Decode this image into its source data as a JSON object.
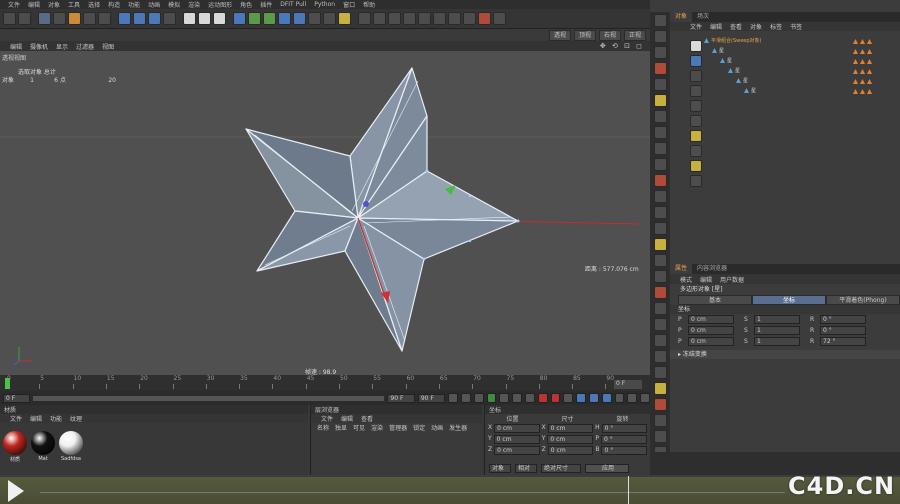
{
  "menu": [
    "文件",
    "编辑",
    "对象",
    "工具",
    "选择",
    "构造",
    "功能",
    "动画",
    "模拟",
    "渲染",
    "运动图形",
    "角色",
    "插件",
    "DFIT Pull",
    "Python",
    "窗口",
    "帮助"
  ],
  "viewport": {
    "view_buttons": [
      "透视",
      "顶视",
      "右视",
      "正视"
    ],
    "menu": [
      "编辑",
      "摄像机",
      "显示",
      "过滤器",
      "视图"
    ],
    "nav_icons": "✥ ⟲ ⊡ ◻",
    "title": "透视视图",
    "info_header": "选取对象 总计",
    "info_rows": [
      {
        "k": "对象",
        "a": "1",
        "b": "6"
      },
      {
        "k": "点",
        "a": "",
        "b": "20"
      }
    ],
    "distance": "距离 : 577.076 cm",
    "speed": "帧速 : 98.9"
  },
  "timeline": {
    "ticks": [
      "0",
      "5",
      "10",
      "15",
      "20",
      "25",
      "30",
      "35",
      "40",
      "45",
      "50",
      "55",
      "60",
      "65",
      "70",
      "75",
      "80",
      "85",
      "90"
    ],
    "frame": "0 F",
    "start": "0 F",
    "end": "90 F",
    "end2": "90 F"
  },
  "materials": {
    "title": "材质",
    "menu": [
      "文件",
      "编辑",
      "功能",
      "纹理"
    ],
    "items": [
      {
        "label": "材质",
        "color": "#c0281e"
      },
      {
        "label": "Mat",
        "color": "#111111"
      },
      {
        "label": "Sadfdsa",
        "color": "#f0f0f0"
      }
    ]
  },
  "layers": {
    "title": "层浏览器",
    "menu": [
      "文件",
      "编辑",
      "查看"
    ],
    "cols": [
      "名称",
      "独显",
      "可见",
      "渲染",
      "管理器",
      "锁定",
      "动画",
      "发生器"
    ]
  },
  "coords": {
    "title": "坐标",
    "cols": [
      "位置",
      "尺寸",
      "旋转"
    ],
    "rows": [
      {
        "a": "X",
        "pos": "0 cm",
        "b": "X",
        "size": "0 cm",
        "c": "H",
        "rot": "0 °"
      },
      {
        "a": "Y",
        "pos": "0 cm",
        "b": "Y",
        "size": "0 cm",
        "c": "P",
        "rot": "0 °"
      },
      {
        "a": "Z",
        "pos": "0 cm",
        "b": "Z",
        "size": "0 cm",
        "c": "B",
        "rot": "0 °"
      }
    ],
    "mode": "对象",
    "mode2": "相对",
    "mode3": "绝对尺寸",
    "apply": "应用"
  },
  "objects": {
    "tabs": [
      "对象",
      "场次"
    ],
    "menu": [
      "文件",
      "编辑",
      "查看",
      "对象",
      "标签",
      "书签"
    ],
    "rows": [
      "平滑组合(Sweep对象)",
      "星",
      "星",
      "星",
      "星",
      "星"
    ]
  },
  "attributes": {
    "tabs": [
      "属性",
      "内容浏览器"
    ],
    "menu": [
      "模式",
      "编辑",
      "用户数据"
    ],
    "title": "多边形对象 [星]",
    "subtabs": [
      "基本",
      "坐标",
      "平滑着色(Phong)"
    ],
    "section": "坐标",
    "rows": [
      {
        "l1": "P",
        "v1": "0 cm",
        "l2": "S",
        "v2": "1",
        "l3": "R",
        "v3": "0 °"
      },
      {
        "l1": "P",
        "v1": "0 cm",
        "l2": "S",
        "v2": "1",
        "l3": "R",
        "v3": "0 °"
      },
      {
        "l1": "P",
        "v1": "0 cm",
        "l2": "S",
        "v2": "1",
        "l3": "R",
        "v3": "72 °"
      }
    ],
    "foot": "▸ 冻结变换"
  },
  "watermark": "C4D.CN"
}
